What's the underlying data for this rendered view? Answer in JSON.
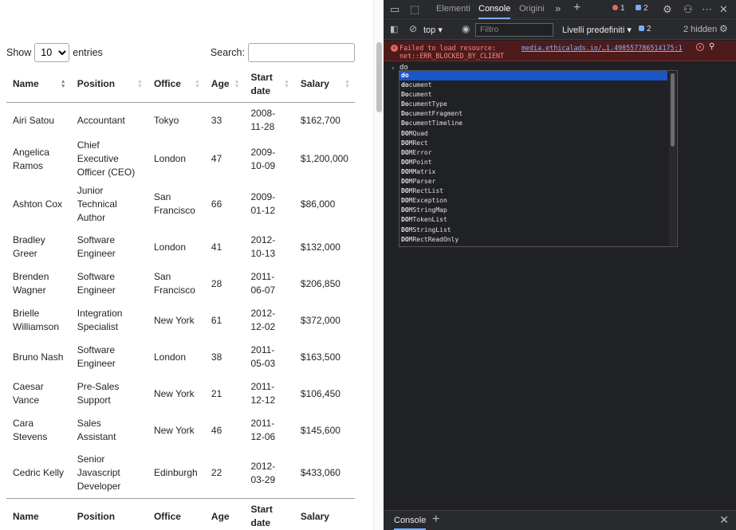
{
  "page": {
    "length": {
      "label_show": "Show",
      "selected": "10",
      "label_entries": "entries"
    },
    "search_label": "Search:",
    "headers": [
      {
        "l1": "Name",
        "l2": ""
      },
      {
        "l1": "Position",
        "l2": ""
      },
      {
        "l1": "Office",
        "l2": ""
      },
      {
        "l1": "Age",
        "l2": ""
      },
      {
        "l1": "Start",
        "l2": "date"
      },
      {
        "l1": "Salary",
        "l2": ""
      }
    ],
    "rows": [
      {
        "name": [
          "Airi Satou"
        ],
        "position": [
          "Accountant"
        ],
        "office": [
          "Tokyo"
        ],
        "age": "33",
        "start": [
          "2008-",
          "11-28"
        ],
        "salary": "$162,700"
      },
      {
        "name": [
          "Angelica",
          "Ramos"
        ],
        "position": [
          "Chief Executive",
          "Officer (CEO)"
        ],
        "office": [
          "London"
        ],
        "age": "47",
        "start": [
          "2009-",
          "10-09"
        ],
        "salary": "$1,200,000"
      },
      {
        "name": [
          "Ashton Cox"
        ],
        "position": [
          "Junior",
          "Technical",
          "Author"
        ],
        "office": [
          "San",
          "Francisco"
        ],
        "age": "66",
        "start": [
          "2009-",
          "01-12"
        ],
        "salary": "$86,000"
      },
      {
        "name": [
          "Bradley",
          "Greer"
        ],
        "position": [
          "Software",
          "Engineer"
        ],
        "office": [
          "London"
        ],
        "age": "41",
        "start": [
          "2012-",
          "10-13"
        ],
        "salary": "$132,000"
      },
      {
        "name": [
          "Brenden",
          "Wagner"
        ],
        "position": [
          "Software",
          "Engineer"
        ],
        "office": [
          "San",
          "Francisco"
        ],
        "age": "28",
        "start": [
          "2011-",
          "06-07"
        ],
        "salary": "$206,850"
      },
      {
        "name": [
          "Brielle",
          "Williamson"
        ],
        "position": [
          "Integration",
          "Specialist"
        ],
        "office": [
          "New York"
        ],
        "age": "61",
        "start": [
          "2012-",
          "12-02"
        ],
        "salary": "$372,000"
      },
      {
        "name": [
          "Bruno Nash"
        ],
        "position": [
          "Software",
          "Engineer"
        ],
        "office": [
          "London"
        ],
        "age": "38",
        "start": [
          "2011-",
          "05-03"
        ],
        "salary": "$163,500"
      },
      {
        "name": [
          "Caesar",
          "Vance"
        ],
        "position": [
          "Pre-Sales",
          "Support"
        ],
        "office": [
          "New York"
        ],
        "age": "21",
        "start": [
          "2011-",
          "12-12"
        ],
        "salary": "$106,450"
      },
      {
        "name": [
          "Cara",
          "Stevens"
        ],
        "position": [
          "Sales Assistant"
        ],
        "office": [
          "New York"
        ],
        "age": "46",
        "start": [
          "2011-",
          "12-06"
        ],
        "salary": "$145,600"
      },
      {
        "name": [
          "Cedric Kelly"
        ],
        "position": [
          "Senior",
          "Javascript",
          "Developer"
        ],
        "office": [
          "Edinburgh"
        ],
        "age": "22",
        "start": [
          "2012-",
          "03-29"
        ],
        "salary": "$433,060"
      }
    ]
  },
  "devtools": {
    "tabs": [
      "Elementi",
      "Console",
      "Origini"
    ],
    "active_tab": "Console",
    "error_count": "1",
    "message_count": "2",
    "context": "top",
    "filter_placeholder": "Filtro",
    "levels": "Livelli predefiniti",
    "toolbar_msg_count": "2",
    "hidden_count": "2 hidden",
    "error": {
      "line1": "Failed to load resource:",
      "line2": "net::ERR_BLOCKED_BY_CLIENT",
      "link": "media.ethicalads.io/…1.498557786514175:1"
    },
    "prompt_text": "do",
    "suggestions": [
      {
        "typed": "do",
        "rest": ""
      },
      {
        "typed": "do",
        "rest": "cument"
      },
      {
        "typed": "Do",
        "rest": "cument"
      },
      {
        "typed": "Do",
        "rest": "cumentType"
      },
      {
        "typed": "Do",
        "rest": "cumentFragment"
      },
      {
        "typed": "Do",
        "rest": "cumentTimeline"
      },
      {
        "typed": "DO",
        "rest": "MQuad"
      },
      {
        "typed": "DO",
        "rest": "MRect"
      },
      {
        "typed": "DO",
        "rest": "MError"
      },
      {
        "typed": "DO",
        "rest": "MPoint"
      },
      {
        "typed": "DO",
        "rest": "MMatrix"
      },
      {
        "typed": "DO",
        "rest": "MParser"
      },
      {
        "typed": "DO",
        "rest": "MRectList"
      },
      {
        "typed": "DO",
        "rest": "MException"
      },
      {
        "typed": "DO",
        "rest": "MStringMap"
      },
      {
        "typed": "DO",
        "rest": "MTokenList"
      },
      {
        "typed": "DO",
        "rest": "MStringList"
      },
      {
        "typed": "DO",
        "rest": "MRectReadOnly"
      }
    ],
    "drawer_tab": "Console"
  },
  "colors": {
    "devtools_bg": "#202124",
    "error_bg": "#4e1b1c",
    "selection": "#1a56c7",
    "accent": "#7cacf8"
  }
}
